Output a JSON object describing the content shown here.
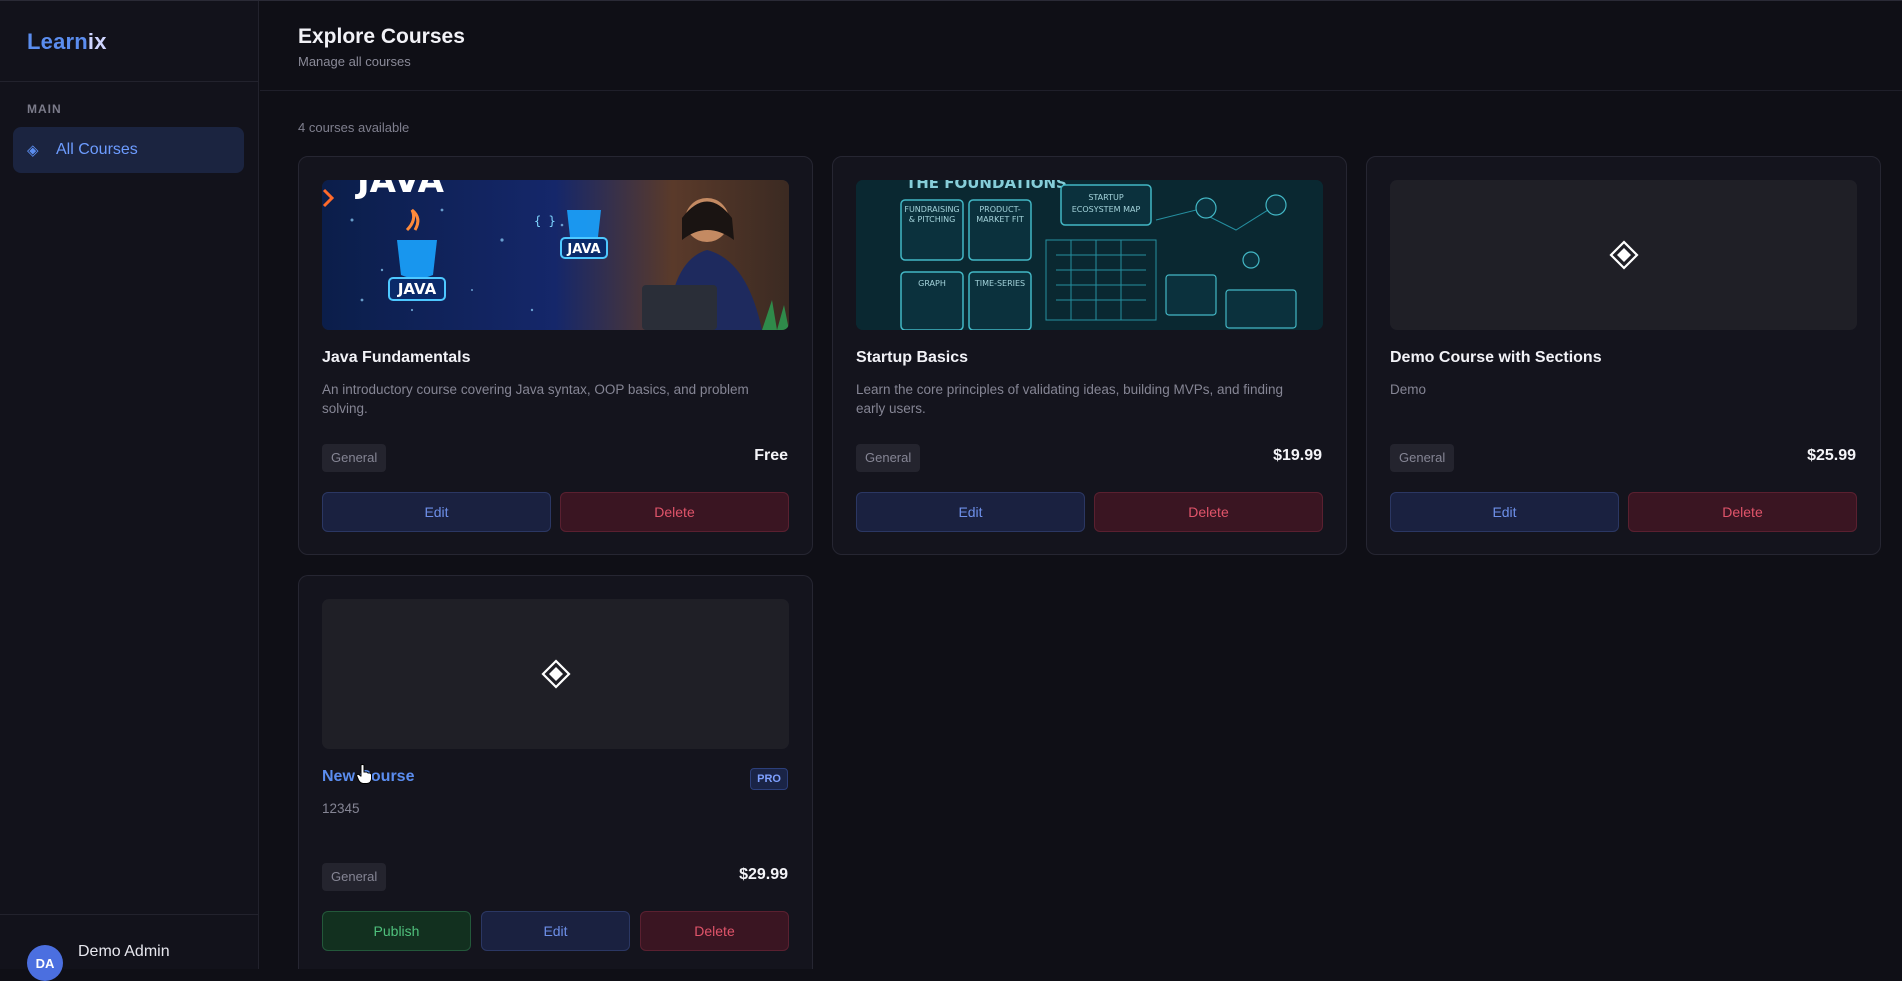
{
  "app": {
    "logo_part1": "Learn",
    "logo_part2": "ix"
  },
  "sidebar": {
    "section_label": "MAIN",
    "items": [
      {
        "label": "All Courses",
        "icon": "diamond-icon",
        "active": true
      }
    ],
    "user": {
      "initials": "DA",
      "name": "Demo Admin"
    }
  },
  "header": {
    "title": "Explore Courses",
    "subtitle": "Manage all courses"
  },
  "main": {
    "count_text": "4 courses available",
    "courses": [
      {
        "title": "Java Fundamentals",
        "description": "An introductory course covering Java syntax, OOP basics, and problem solving.",
        "category": "General",
        "price": "Free",
        "thumbnail": "java-illustration",
        "edit_label": "Edit",
        "delete_label": "Delete"
      },
      {
        "title": "Startup Basics",
        "description": "Learn the core principles of validating ideas, building MVPs, and finding early users.",
        "category": "General",
        "price": "$19.99",
        "thumbnail": "startup-illustration",
        "edit_label": "Edit",
        "delete_label": "Delete"
      },
      {
        "title": "Demo Course with Sections",
        "description": "Demo",
        "category": "General",
        "price": "$25.99",
        "thumbnail": "placeholder-diamond-icon",
        "edit_label": "Edit",
        "delete_label": "Delete"
      },
      {
        "title": "New Course",
        "description": "12345",
        "category": "General",
        "price": "$29.99",
        "badge": "PRO",
        "thumbnail": "placeholder-diamond-icon",
        "publish_label": "Publish",
        "edit_label": "Edit",
        "delete_label": "Delete"
      }
    ]
  },
  "colors": {
    "accent": "#5b8def",
    "background": "#0f0f16",
    "card": "#14141d",
    "delete": "#e0546a",
    "publish": "#4fc07c"
  }
}
